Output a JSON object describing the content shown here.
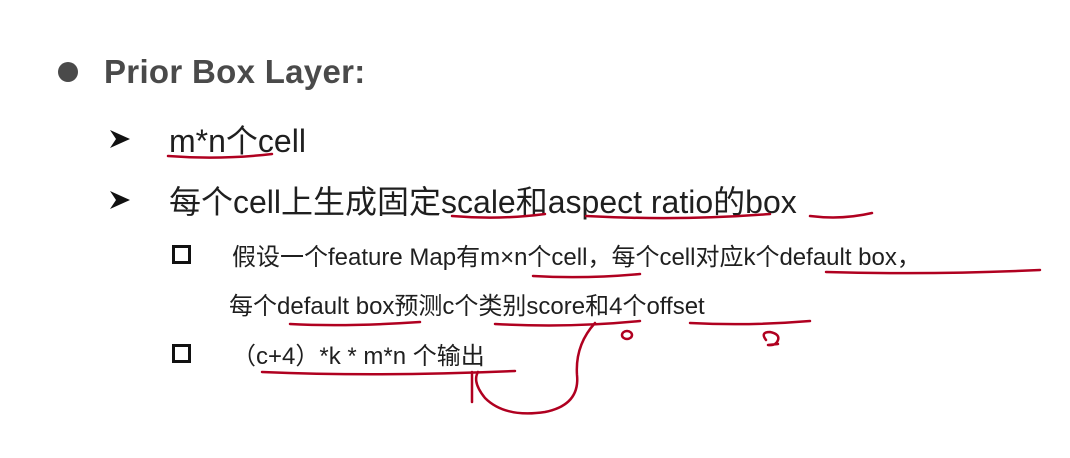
{
  "slide": {
    "heading": "Prior Box Layer:",
    "items": [
      {
        "text": "m*n个cell"
      },
      {
        "text": "每个cell上生成固定scale和aspect ratio的box"
      }
    ],
    "subitems": [
      {
        "line1": "假设一个feature Map有m×n个cell，每个cell对应k个default box，",
        "line2": "每个default box预测c个类别score和4个offset"
      },
      {
        "line1": "（c+4）*k * m*n 个输出"
      }
    ]
  },
  "colors": {
    "heading": "#4a4a4a",
    "text": "#1f1f1f",
    "annotation": "#b00020"
  }
}
